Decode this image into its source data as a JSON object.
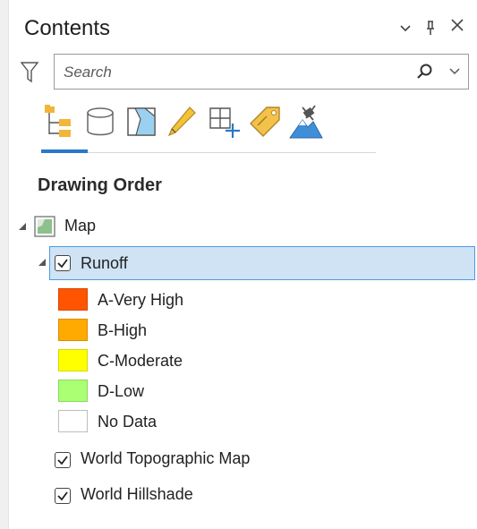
{
  "panel": {
    "title": "Contents"
  },
  "search": {
    "placeholder": "Search"
  },
  "toolbar": {
    "icons": [
      "list-by-drawing-order-icon",
      "list-by-source-icon",
      "list-by-selection-icon",
      "list-by-editing-icon",
      "list-by-snapping-icon",
      "list-by-labeling-icon",
      "list-by-perspective-imagery-icon"
    ]
  },
  "section": {
    "heading": "Drawing Order"
  },
  "tree": {
    "map": {
      "label": "Map"
    },
    "runoff": {
      "label": "Runoff",
      "checked": true,
      "legend": [
        {
          "label": "A-Very High",
          "color": "#ff5500"
        },
        {
          "label": "B-High",
          "color": "#ffaa00"
        },
        {
          "label": "C-Moderate",
          "color": "#ffff00"
        },
        {
          "label": "D-Low",
          "color": "#aaff73"
        },
        {
          "label": "No Data",
          "color": "#ffffff"
        }
      ]
    },
    "layers": [
      {
        "label": "World Topographic Map",
        "checked": true
      },
      {
        "label": "World Hillshade",
        "checked": true
      }
    ]
  }
}
